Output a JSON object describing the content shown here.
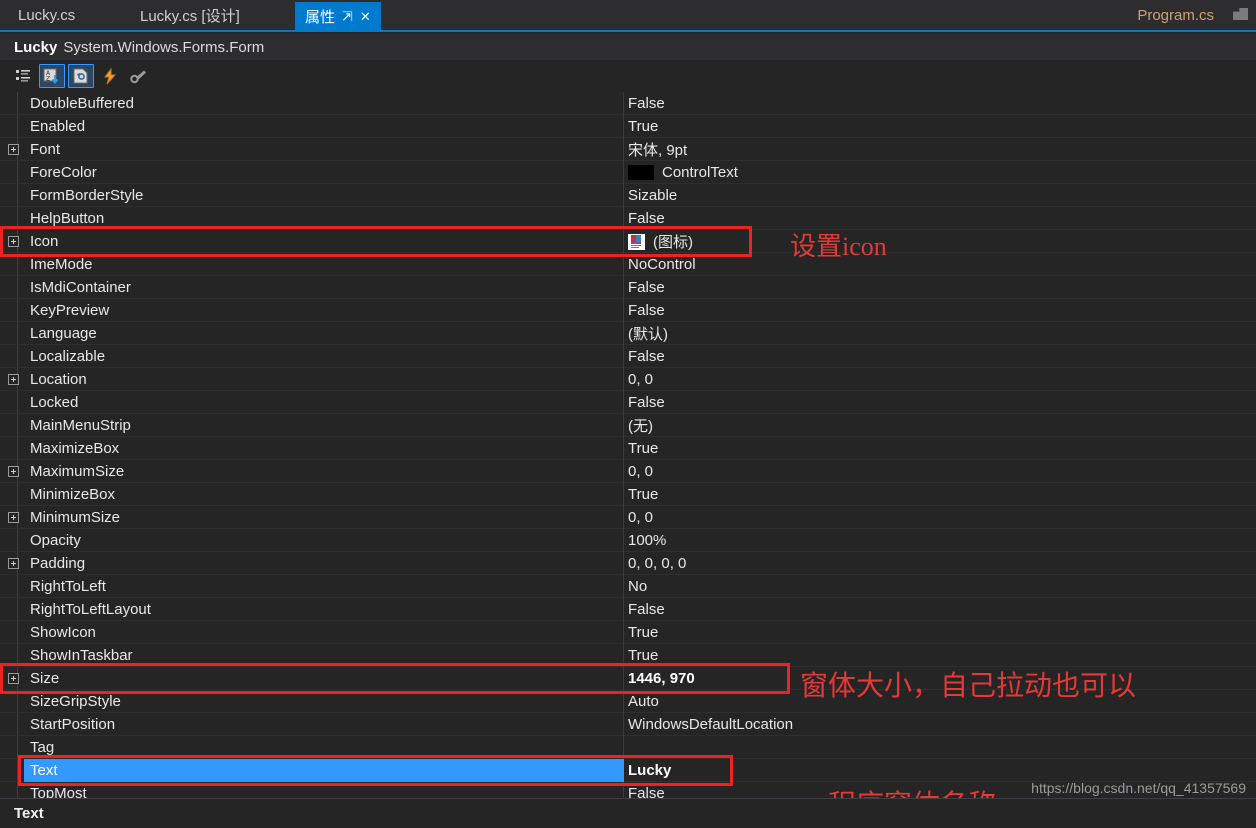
{
  "tabs": [
    {
      "label": "Lucky.cs",
      "active": false
    },
    {
      "label": "Lucky.cs [设计]",
      "active": false
    },
    {
      "label": "属性",
      "active": true,
      "pin": "⇱",
      "close": "✕"
    },
    {
      "label": "Program.cs",
      "active": false
    }
  ],
  "object_header": {
    "name": "Lucky",
    "type": "System.Windows.Forms.Form"
  },
  "toolbar": {
    "buttons": [
      {
        "name": "categorized-icon",
        "selected": false
      },
      {
        "name": "alphabetical-sort-icon",
        "selected": true
      },
      {
        "name": "properties-icon",
        "selected": true
      },
      {
        "name": "events-icon",
        "selected": false
      },
      {
        "name": "property-pages-icon",
        "selected": false
      }
    ]
  },
  "properties": [
    {
      "name": "DoubleBuffered",
      "value": "False",
      "expandable": false,
      "bold": false
    },
    {
      "name": "Enabled",
      "value": "True",
      "expandable": false,
      "bold": false
    },
    {
      "name": "Font",
      "value": "宋体, 9pt",
      "expandable": true,
      "bold": false
    },
    {
      "name": "ForeColor",
      "value": "ControlText",
      "expandable": false,
      "bold": false,
      "swatch": "#000000"
    },
    {
      "name": "FormBorderStyle",
      "value": "Sizable",
      "expandable": false,
      "bold": false
    },
    {
      "name": "HelpButton",
      "value": "False",
      "expandable": false,
      "bold": false
    },
    {
      "name": "Icon",
      "value": "(图标)",
      "expandable": true,
      "bold": false,
      "thumb": true
    },
    {
      "name": "ImeMode",
      "value": "NoControl",
      "expandable": false,
      "bold": false
    },
    {
      "name": "IsMdiContainer",
      "value": "False",
      "expandable": false,
      "bold": false
    },
    {
      "name": "KeyPreview",
      "value": "False",
      "expandable": false,
      "bold": false
    },
    {
      "name": "Language",
      "value": "(默认)",
      "expandable": false,
      "bold": false
    },
    {
      "name": "Localizable",
      "value": "False",
      "expandable": false,
      "bold": false
    },
    {
      "name": "Location",
      "value": "0, 0",
      "expandable": true,
      "bold": false
    },
    {
      "name": "Locked",
      "value": "False",
      "expandable": false,
      "bold": false
    },
    {
      "name": "MainMenuStrip",
      "value": "(无)",
      "expandable": false,
      "bold": false
    },
    {
      "name": "MaximizeBox",
      "value": "True",
      "expandable": false,
      "bold": false
    },
    {
      "name": "MaximumSize",
      "value": "0, 0",
      "expandable": true,
      "bold": false
    },
    {
      "name": "MinimizeBox",
      "value": "True",
      "expandable": false,
      "bold": false
    },
    {
      "name": "MinimumSize",
      "value": "0, 0",
      "expandable": true,
      "bold": false
    },
    {
      "name": "Opacity",
      "value": "100%",
      "expandable": false,
      "bold": false
    },
    {
      "name": "Padding",
      "value": "0, 0, 0, 0",
      "expandable": true,
      "bold": false
    },
    {
      "name": "RightToLeft",
      "value": "No",
      "expandable": false,
      "bold": false
    },
    {
      "name": "RightToLeftLayout",
      "value": "False",
      "expandable": false,
      "bold": false
    },
    {
      "name": "ShowIcon",
      "value": "True",
      "expandable": false,
      "bold": false
    },
    {
      "name": "ShowInTaskbar",
      "value": "True",
      "expandable": false,
      "bold": false
    },
    {
      "name": "Size",
      "value": "1446, 970",
      "expandable": true,
      "bold": true
    },
    {
      "name": "SizeGripStyle",
      "value": "Auto",
      "expandable": false,
      "bold": false
    },
    {
      "name": "StartPosition",
      "value": "WindowsDefaultLocation",
      "expandable": false,
      "bold": false
    },
    {
      "name": "Tag",
      "value": "",
      "expandable": false,
      "bold": false
    },
    {
      "name": "Text",
      "value": "Lucky",
      "expandable": false,
      "bold": true,
      "selected": true
    },
    {
      "name": "TopMost",
      "value": "False",
      "expandable": false,
      "bold": false
    }
  ],
  "annotations": [
    {
      "text": "设置icon",
      "target": "Icon"
    },
    {
      "text": "窗体大小，自己拉动也可以",
      "target": "Size"
    },
    {
      "text": "程序窗体名称",
      "target": "Text"
    }
  ],
  "description_panel": {
    "title": "Text"
  },
  "watermark": "https://blog.csdn.net/qq_41357569",
  "colors": {
    "accent": "#007acc",
    "selection": "#3399ff",
    "annotation": "#e53935",
    "background": "#252526"
  }
}
